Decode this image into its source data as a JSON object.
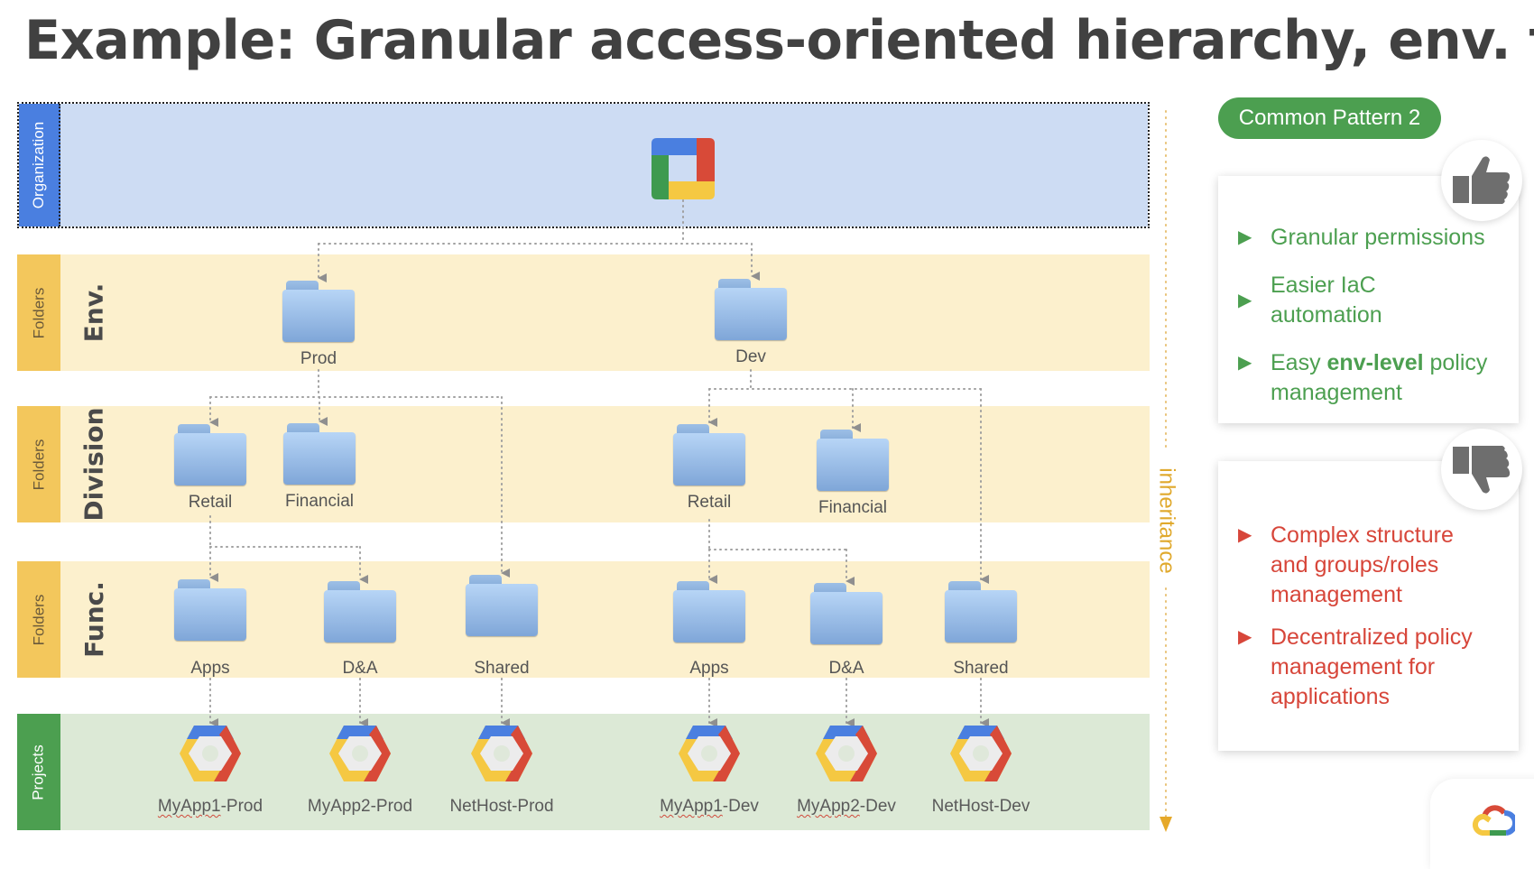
{
  "title": "Example: Granular access-oriented hierarchy, env. first",
  "bands": {
    "organization": {
      "tag": "Organization",
      "level": ""
    },
    "env": {
      "tag": "Folders",
      "level": "Env."
    },
    "division": {
      "tag": "Folders",
      "level": "Division"
    },
    "func": {
      "tag": "Folders",
      "level": "Func."
    },
    "projects": {
      "tag": "Projects",
      "level": ""
    }
  },
  "env_folders": [
    {
      "label": "Prod"
    },
    {
      "label": "Dev"
    }
  ],
  "division_folders": [
    {
      "label": "Retail",
      "parent": "Prod"
    },
    {
      "label": "Financial",
      "parent": "Prod"
    },
    {
      "label": "Retail",
      "parent": "Dev"
    },
    {
      "label": "Financial",
      "parent": "Dev"
    }
  ],
  "func_folders": [
    {
      "label": "Apps",
      "parent": "Retail (Prod)"
    },
    {
      "label": "D&A",
      "parent": "Retail (Prod)"
    },
    {
      "label": "Shared",
      "parent": "Prod"
    },
    {
      "label": "Apps",
      "parent": "Retail (Dev)"
    },
    {
      "label": "D&A",
      "parent": "Retail (Dev)"
    },
    {
      "label": "Shared",
      "parent": "Dev"
    }
  ],
  "projects": [
    {
      "label": "MyApp1-Prod",
      "spellcheck": true
    },
    {
      "label": "MyApp2-Prod",
      "spellcheck": false
    },
    {
      "label": "NetHost-Prod",
      "spellcheck": false
    },
    {
      "label": "MyApp1-Dev",
      "spellcheck": true
    },
    {
      "label": "MyApp2-Dev",
      "spellcheck": true
    },
    {
      "label": "NetHost-Dev",
      "spellcheck": false
    }
  ],
  "inheritance_label": "inheritance",
  "pattern_badge": "Common Pattern 2",
  "pros": {
    "icon": "thumbs-up-icon",
    "items": [
      {
        "text": "Granular permissions"
      },
      {
        "pre": "Easier IaC automation"
      },
      {
        "pre": "Easy ",
        "bold": "env-level",
        "post": " policy management"
      }
    ]
  },
  "cons": {
    "icon": "thumbs-down-icon",
    "items": [
      {
        "text": "Complex structure and groups/roles management"
      },
      {
        "text": "Decentralized policy management for applications"
      }
    ]
  },
  "colors": {
    "org_tag": "#4a7fe0",
    "org_bg": "#cddcf3",
    "folder_tag": "#f3c75c",
    "folder_bg": "#fcf0cd",
    "project_tag": "#4c9f50",
    "project_bg": "#dce9d6",
    "pro_text": "#4c9f50",
    "con_text": "#d7463a",
    "inheritance": "#e0a92d"
  },
  "bullet_glyph": "▶"
}
